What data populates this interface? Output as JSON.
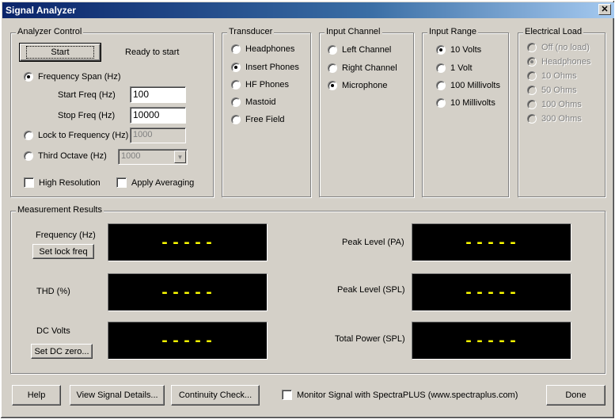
{
  "window": {
    "title": "Signal Analyzer",
    "close_glyph": "✕"
  },
  "analyzer_control": {
    "title": "Analyzer Control",
    "start_label": "Start",
    "status": "Ready to start",
    "freq_span_label": "Frequency Span (Hz)",
    "start_freq_label": "Start Freq (Hz)",
    "start_freq_value": "100",
    "stop_freq_label": "Stop Freq (Hz)",
    "stop_freq_value": "10000",
    "lock_label": "Lock to Frequency (Hz)",
    "lock_value": "1000",
    "third_octave_label": "Third Octave (Hz)",
    "third_octave_value": "1000",
    "high_res_label": "High Resolution",
    "averaging_label": "Apply Averaging",
    "selected": "freq_span"
  },
  "transducer": {
    "title": "Transducer",
    "options": [
      "Headphones",
      "Insert Phones",
      "HF Phones",
      "Mastoid",
      "Free Field"
    ],
    "selected": 1
  },
  "input_channel": {
    "title": "Input Channel",
    "options": [
      "Left Channel",
      "Right Channel",
      "Microphone"
    ],
    "selected": 2
  },
  "input_range": {
    "title": "Input Range",
    "options": [
      "10 Volts",
      "1 Volt",
      "100 Millivolts",
      "10 Millivolts"
    ],
    "selected": 0
  },
  "electrical_load": {
    "title": "Electrical Load",
    "options": [
      "Off (no load)",
      "Headphones",
      "10 Ohms",
      "50 Ohms",
      "100 Ohms",
      "300 Ohms"
    ],
    "selected": 1
  },
  "results": {
    "title": "Measurement Results",
    "frequency_label": "Frequency (Hz)",
    "set_lock_label": "Set lock freq",
    "thd_label": "THD (%)",
    "dc_label": "DC Volts",
    "set_dc_label": "Set DC zero...",
    "peak_pa_label": "Peak Level (PA)",
    "peak_spl_label": "Peak Level (SPL)",
    "total_power_label": "Total Power (SPL)",
    "placeholder": "-----",
    "display_color": "#ffff00"
  },
  "footer": {
    "help_label": "Help",
    "details_label": "View Signal Details...",
    "continuity_label": "Continuity Check...",
    "monitor_label": "Monitor Signal with SpectraPLUS (www.spectraplus.com)",
    "done_label": "Done"
  }
}
